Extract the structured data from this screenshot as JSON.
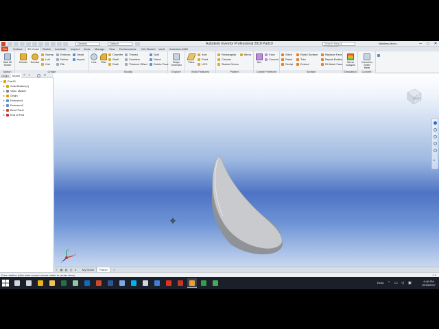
{
  "titlebar": {
    "title": "Autodesk Inventor Professional 2018   Part10",
    "material_combo": "Generic",
    "appearance_combo": "Default",
    "search_placeholder": "Search Help & Commands...",
    "user": "Matthew.Miner...",
    "minimize": "─",
    "maximize": "□",
    "close": "✕"
  },
  "ribbon_tabs": [
    {
      "label": "File",
      "kind": "file"
    },
    {
      "label": "Surface"
    },
    {
      "label": "3D Model",
      "kind": "active"
    },
    {
      "label": "Sketch"
    },
    {
      "label": "Annotate"
    },
    {
      "label": "Inspect"
    },
    {
      "label": "Tools"
    },
    {
      "label": "Manage"
    },
    {
      "label": "View"
    },
    {
      "label": "Environments"
    },
    {
      "label": "Get Started"
    },
    {
      "label": "Vault"
    },
    {
      "label": "Autodesk A360"
    }
  ],
  "ribbon": {
    "sketch_panel": {
      "label": "Sketch",
      "start_sketch": "Start 2D Sketch"
    },
    "create_panel": {
      "label": "Create",
      "extrude": "Extrude",
      "revolve": "Revolve",
      "sweep": "Sweep",
      "loft": "Loft",
      "coil": "Coil",
      "emboss": "Emboss",
      "derive": "Derive",
      "rib": "Rib",
      "decal": "Decal",
      "import": "Import"
    },
    "modify_panel": {
      "label": "Modify",
      "hole": "Hole",
      "fillet": "Fillet",
      "chamfer": "Chamfer",
      "shell": "Shell",
      "draft": "Draft",
      "thread": "Thread",
      "combine": "Combine",
      "thicken": "Thicken/ Offset",
      "split": "Split",
      "direct": "Direct",
      "delete_face": "Delete Face"
    },
    "explore_panel": {
      "label": "Explore",
      "shape_generator": "Shape Generator"
    },
    "work_features_panel": {
      "label": "Work Features",
      "plane": "Plane",
      "axis": "Axis",
      "point": "Point",
      "ucs": "UCS"
    },
    "pattern_panel": {
      "label": "Pattern",
      "rectangular": "Rectangular",
      "circular": "Circular",
      "sketch_driven": "Sketch Driven",
      "mirror": "Mirror"
    },
    "freeform_panel": {
      "label": "Create Freeform",
      "box": "Box",
      "face": "Face",
      "convert": "Convert"
    },
    "surface_panel": {
      "label": "Surface",
      "stitch": "Stitch",
      "patch": "Patch",
      "sculpt": "Sculpt",
      "ruled_surface": "Ruled Surface",
      "trim": "Trim",
      "extend": "Extend",
      "replace_face": "Replace Face",
      "repair_bodies": "Repair Bodies",
      "fit_mesh_face": "Fit Mesh Face"
    },
    "simulation_panel": {
      "label": "Simulation",
      "stress_analysis": "Stress Analysis"
    },
    "convert_panel": {
      "label": "Convert",
      "convert_sheet_metal": "Convert to Sheet Metal"
    }
  },
  "browser": {
    "tabs": [
      "Origin",
      "Model"
    ],
    "close": "×",
    "add": "+",
    "tree": [
      {
        "label": "Part10",
        "level": 0,
        "icon_color": "#d8a200"
      },
      {
        "label": "Solid Bodies(1)",
        "level": 1,
        "icon_color": "#d8a200"
      },
      {
        "label": "View: Master",
        "level": 1,
        "icon_color": "#7a8a99"
      },
      {
        "label": "Origin",
        "level": 1,
        "icon_color": "#d8a200"
      },
      {
        "label": "Extrusion1",
        "level": 1,
        "icon_color": "#5c8fd6"
      },
      {
        "label": "Extrusion2",
        "level": 1,
        "icon_color": "#5c8fd6"
      },
      {
        "label": "Bend Part1",
        "level": 1,
        "icon_color": "#c2522e"
      },
      {
        "label": "End of Part",
        "level": 1,
        "icon_color": "#c0392b"
      }
    ]
  },
  "viewcube": {
    "face_label": "RIGHT"
  },
  "triad": {
    "x_label": "X",
    "y_label": "Y",
    "z_label": "Z"
  },
  "doc_tabs": [
    {
      "label": "My Home"
    },
    {
      "label": "Part10",
      "active": true
    }
  ],
  "statusbar": {
    "message": "Free rotation (click when cursor shows rotate to center view)",
    "counts": "1   1"
  },
  "taskbar": {
    "apps": [
      {
        "name": "search",
        "color": "#cfd6e0"
      },
      {
        "name": "task-view",
        "color": "#cfd6e0"
      },
      {
        "name": "chrome",
        "color": "#e8b31b"
      },
      {
        "name": "file-explorer",
        "color": "#f2c44f"
      },
      {
        "name": "excel",
        "color": "#217346"
      },
      {
        "name": "photos",
        "color": "#8fc7a3"
      },
      {
        "name": "outlook",
        "color": "#0f6cbd"
      },
      {
        "name": "powerpoint",
        "color": "#d24726"
      },
      {
        "name": "word",
        "color": "#2b579a"
      },
      {
        "name": "onenote",
        "color": "#7ea8e3"
      },
      {
        "name": "skype",
        "color": "#00aff0"
      },
      {
        "name": "mail",
        "color": "#cfd6e0"
      },
      {
        "name": "solidworks",
        "color": "#3d7fd6"
      },
      {
        "name": "acrobat",
        "color": "#e0301e"
      },
      {
        "name": "autocad",
        "color": "#c0392b"
      },
      {
        "name": "inventor",
        "color": "#f0a030"
      },
      {
        "name": "camtasia",
        "color": "#2e9e4f"
      },
      {
        "name": "camtasia-recorder",
        "color": "#3fae5f"
      }
    ],
    "tray_text": "Extra",
    "time": "6:46 PM",
    "date": "10/15/2017"
  }
}
